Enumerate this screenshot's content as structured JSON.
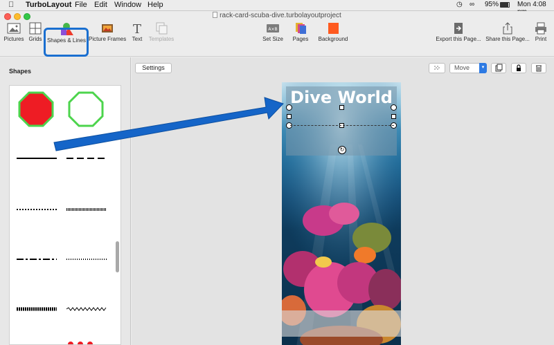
{
  "menubar": {
    "app_name": "TurboLayout",
    "items": [
      "File",
      "Edit",
      "Window",
      "Help"
    ],
    "battery": "95%",
    "clock": "Mon 4:08 pm"
  },
  "window": {
    "title": "rack-card-scuba-dive.turbolayoutproject"
  },
  "toolbar": {
    "pictures": "Pictures",
    "grids": "Grids",
    "shapes_lines": "Shapes & Lines",
    "picture_frames": "Picture Frames",
    "text": "Text",
    "templates": "Templates",
    "set_size": "Set Size",
    "pages": "Pages",
    "background": "Background",
    "export": "Export this Page...",
    "share": "Share this Page...",
    "print": "Print"
  },
  "shapes_panel": {
    "title": "Shapes"
  },
  "canvas_toolbar": {
    "settings": "Settings",
    "move": "Move"
  },
  "document": {
    "title": "Dive World"
  },
  "colors": {
    "accent": "#1a6fd0",
    "octagon_fill": "#ee1c24",
    "octagon_stroke": "#4cd44c",
    "background_swatch": "#ff5a1f"
  }
}
